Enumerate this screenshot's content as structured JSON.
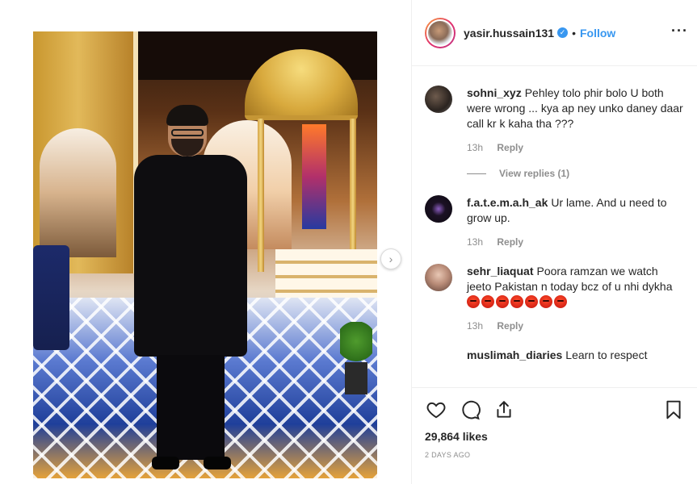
{
  "post": {
    "username": "yasir.hussain131",
    "separator": "•",
    "follow_label": "Follow",
    "more_label": "···",
    "next_label": "›"
  },
  "comments": [
    {
      "username": "sohni_xyz",
      "text": "Pehley tolo phir bolo U both were wrong ... kya ap ney unko daney daar call kr k kaha tha ???",
      "time": "13h",
      "reply_label": "Reply",
      "view_replies_label": "View replies (1)"
    },
    {
      "username": "f.a.t.e.m.a.h_ak",
      "text": "Ur lame. And u need to grow up.",
      "time": "13h",
      "reply_label": "Reply"
    },
    {
      "username": "sehr_liaquat",
      "text": "Poora ramzan we watch jeeto Pakistan n today bcz of u nhi dykha",
      "emoji_count": 7,
      "time": "13h",
      "reply_label": "Reply"
    },
    {
      "username": "muslimah_diaries",
      "text": "Learn to respect"
    }
  ],
  "stats": {
    "likes": "29,864 likes",
    "posted": "2 DAYS AGO"
  },
  "icons": [
    "heart-icon",
    "comment-icon",
    "share-icon",
    "bookmark-icon",
    "verified-icon",
    "chevron-right-icon"
  ],
  "colors": {
    "link_blue": "#3897f0",
    "text": "#262626",
    "muted": "#8e8e8e",
    "border": "#efefef"
  }
}
